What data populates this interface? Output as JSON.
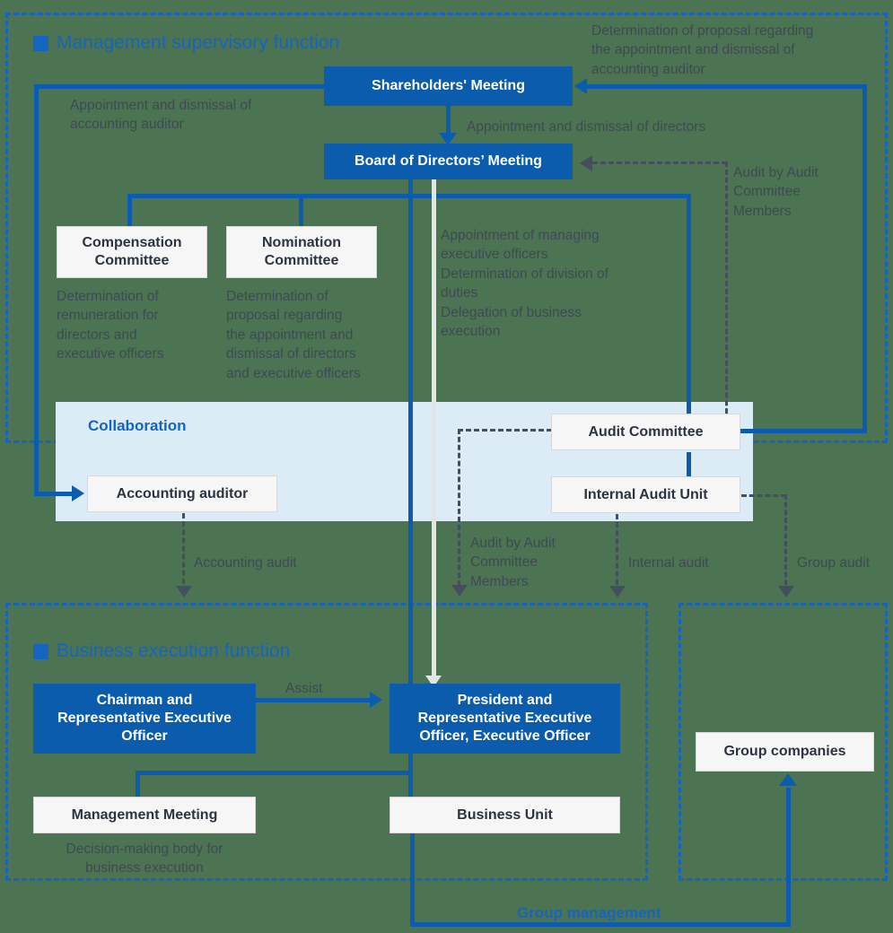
{
  "sections": {
    "supervisory": {
      "title": "Management supervisory function"
    },
    "execution": {
      "title": "Business execution function"
    },
    "group": {
      "label": "Group management"
    }
  },
  "collaboration": {
    "label": "Collaboration"
  },
  "boxes": {
    "shareholders_meeting": "Shareholders' Meeting",
    "board_of_directors": "Board of Directors’ Meeting",
    "compensation_committee": "Compensation\nCommittee",
    "nomination_committee": "Nomination\nCommittee",
    "audit_committee": "Audit Committee",
    "internal_audit_unit": "Internal Audit Unit",
    "accounting_auditor": "Accounting auditor",
    "chairman": "Chairman and\nRepresentative Executive\nOfficer",
    "president": "President and\nRepresentative Executive\nOfficer, Executive Officer",
    "management_meeting": "Management Meeting",
    "business_unit": "Business Unit",
    "group_companies": "Group companies"
  },
  "notes": {
    "appointment_dismissal_accounting_auditor": "Appointment and dismissal of\naccounting auditor",
    "determination_proposal_accounting_auditor": "Determination of proposal regarding\nthe appointment and dismissal of\naccounting auditor",
    "appointment_dismissal_directors": "Appointment and dismissal of directors",
    "audit_by_audit_committee_members_top": "Audit by Audit\nCommittee\nMembers",
    "compensation_committee_role": "Determination of\nremuneration for\ndirectors and\nexecutive officers",
    "nomination_committee_role": "Determination of\nproposal regarding\nthe appointment and\ndismissal of directors\nand executive officers",
    "board_delegation": "Appointment of managing\nexecutive officers\nDetermination of division of\nduties\nDelegation of business\nexecution",
    "accounting_audit": "Accounting audit",
    "audit_by_audit_committee_members_mid": "Audit by Audit\nCommittee\nMembers",
    "internal_audit": "Internal audit",
    "group_audit": "Group audit",
    "assist": "Assist",
    "management_meeting_role": "Decision-making body for\nbusiness execution"
  },
  "colors": {
    "background": "#4c7352",
    "accent_blue": "#0b5cad",
    "section_blue": "#1565c0",
    "panel_blue": "#dcecf7",
    "box_white": "#f6f6f6",
    "note_text": "#3e4a54"
  }
}
